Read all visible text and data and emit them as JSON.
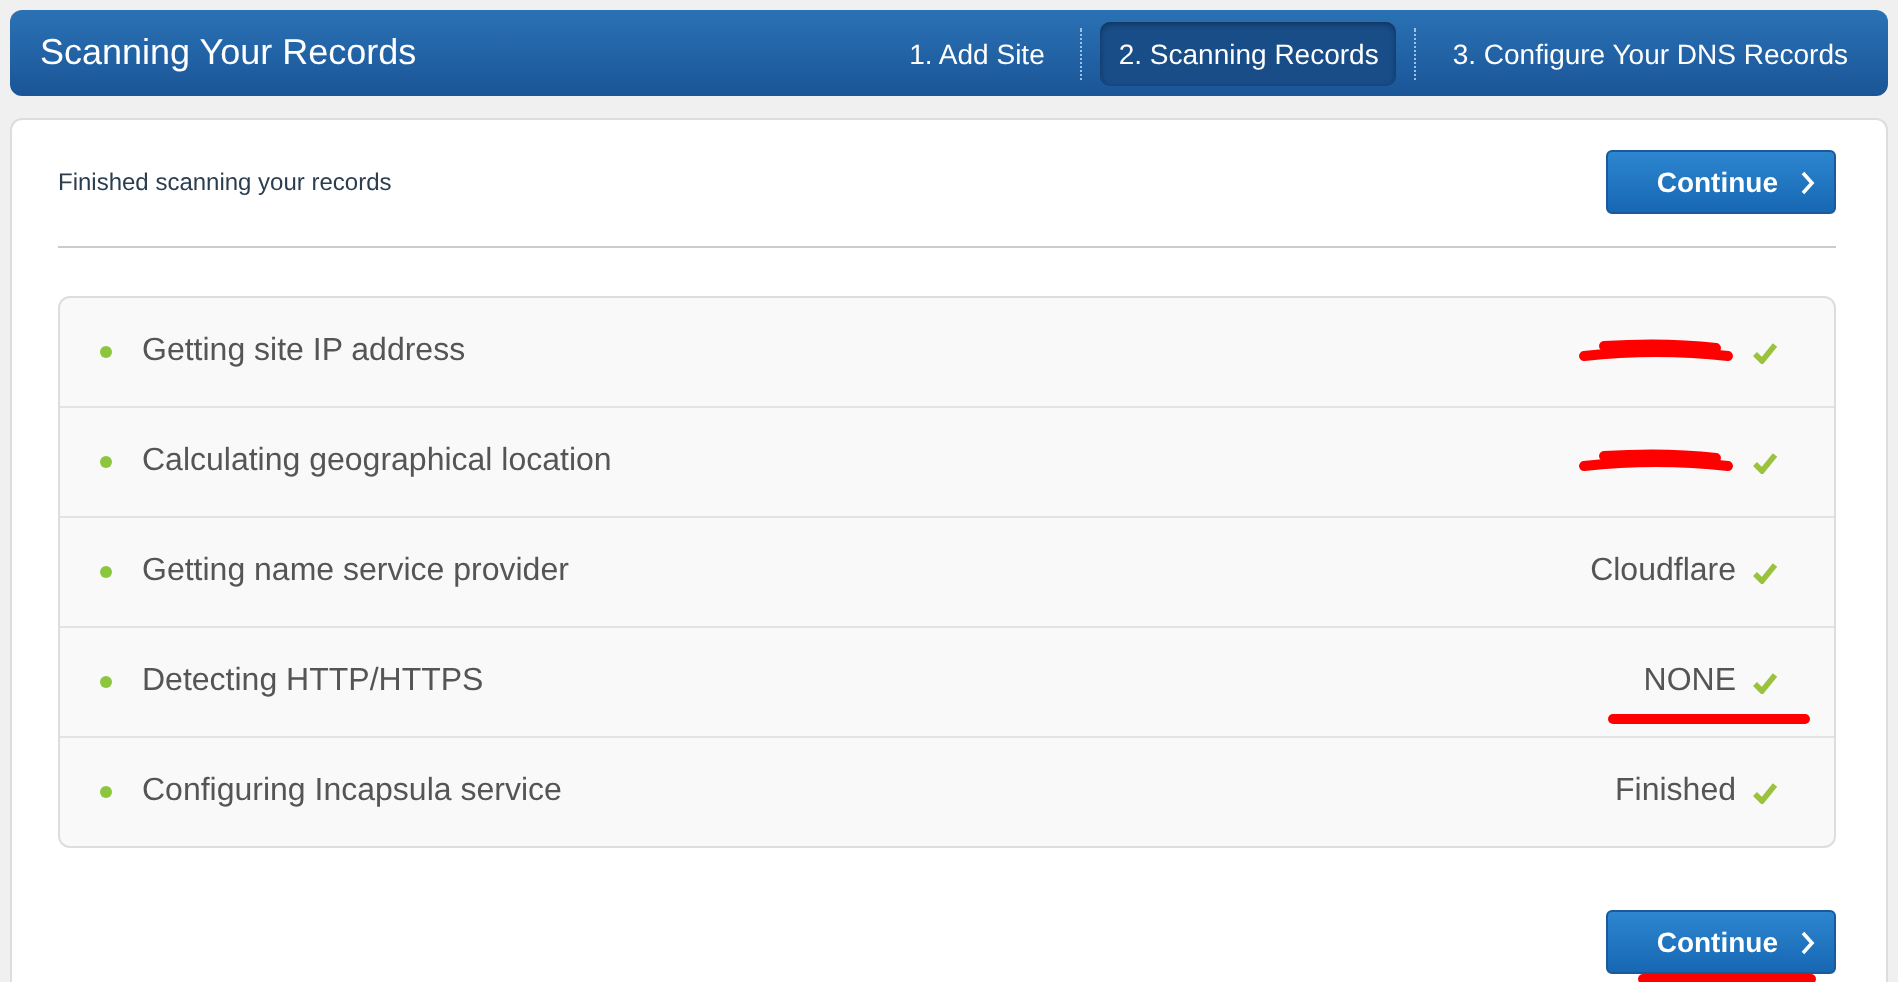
{
  "header": {
    "title": "Scanning Your Records",
    "steps": [
      {
        "label": "1. Add Site",
        "selected": false
      },
      {
        "label": "2. Scanning Records",
        "selected": true
      },
      {
        "label": "3. Configure Your DNS Records",
        "selected": false
      }
    ]
  },
  "status": "Finished scanning your records",
  "top_button": {
    "label": "Continue",
    "underlined": false
  },
  "scan_steps": [
    {
      "label": "Getting site IP address",
      "redacted": true,
      "underlined": false,
      "done": true
    },
    {
      "label": "Calculating geographical location",
      "redacted": true,
      "underlined": false,
      "done": true
    },
    {
      "label": "Getting name service provider",
      "value": "Cloudflare",
      "redacted": false,
      "underlined": false,
      "done": true
    },
    {
      "label": "Detecting HTTP/HTTPS",
      "value": "NONE",
      "redacted": false,
      "underlined": true,
      "done": true
    },
    {
      "label": "Configuring Incapsula service",
      "value": "Finished",
      "redacted": false,
      "underlined": false,
      "done": true
    }
  ],
  "bottom_button": {
    "label": "Continue",
    "underlined": true
  }
}
